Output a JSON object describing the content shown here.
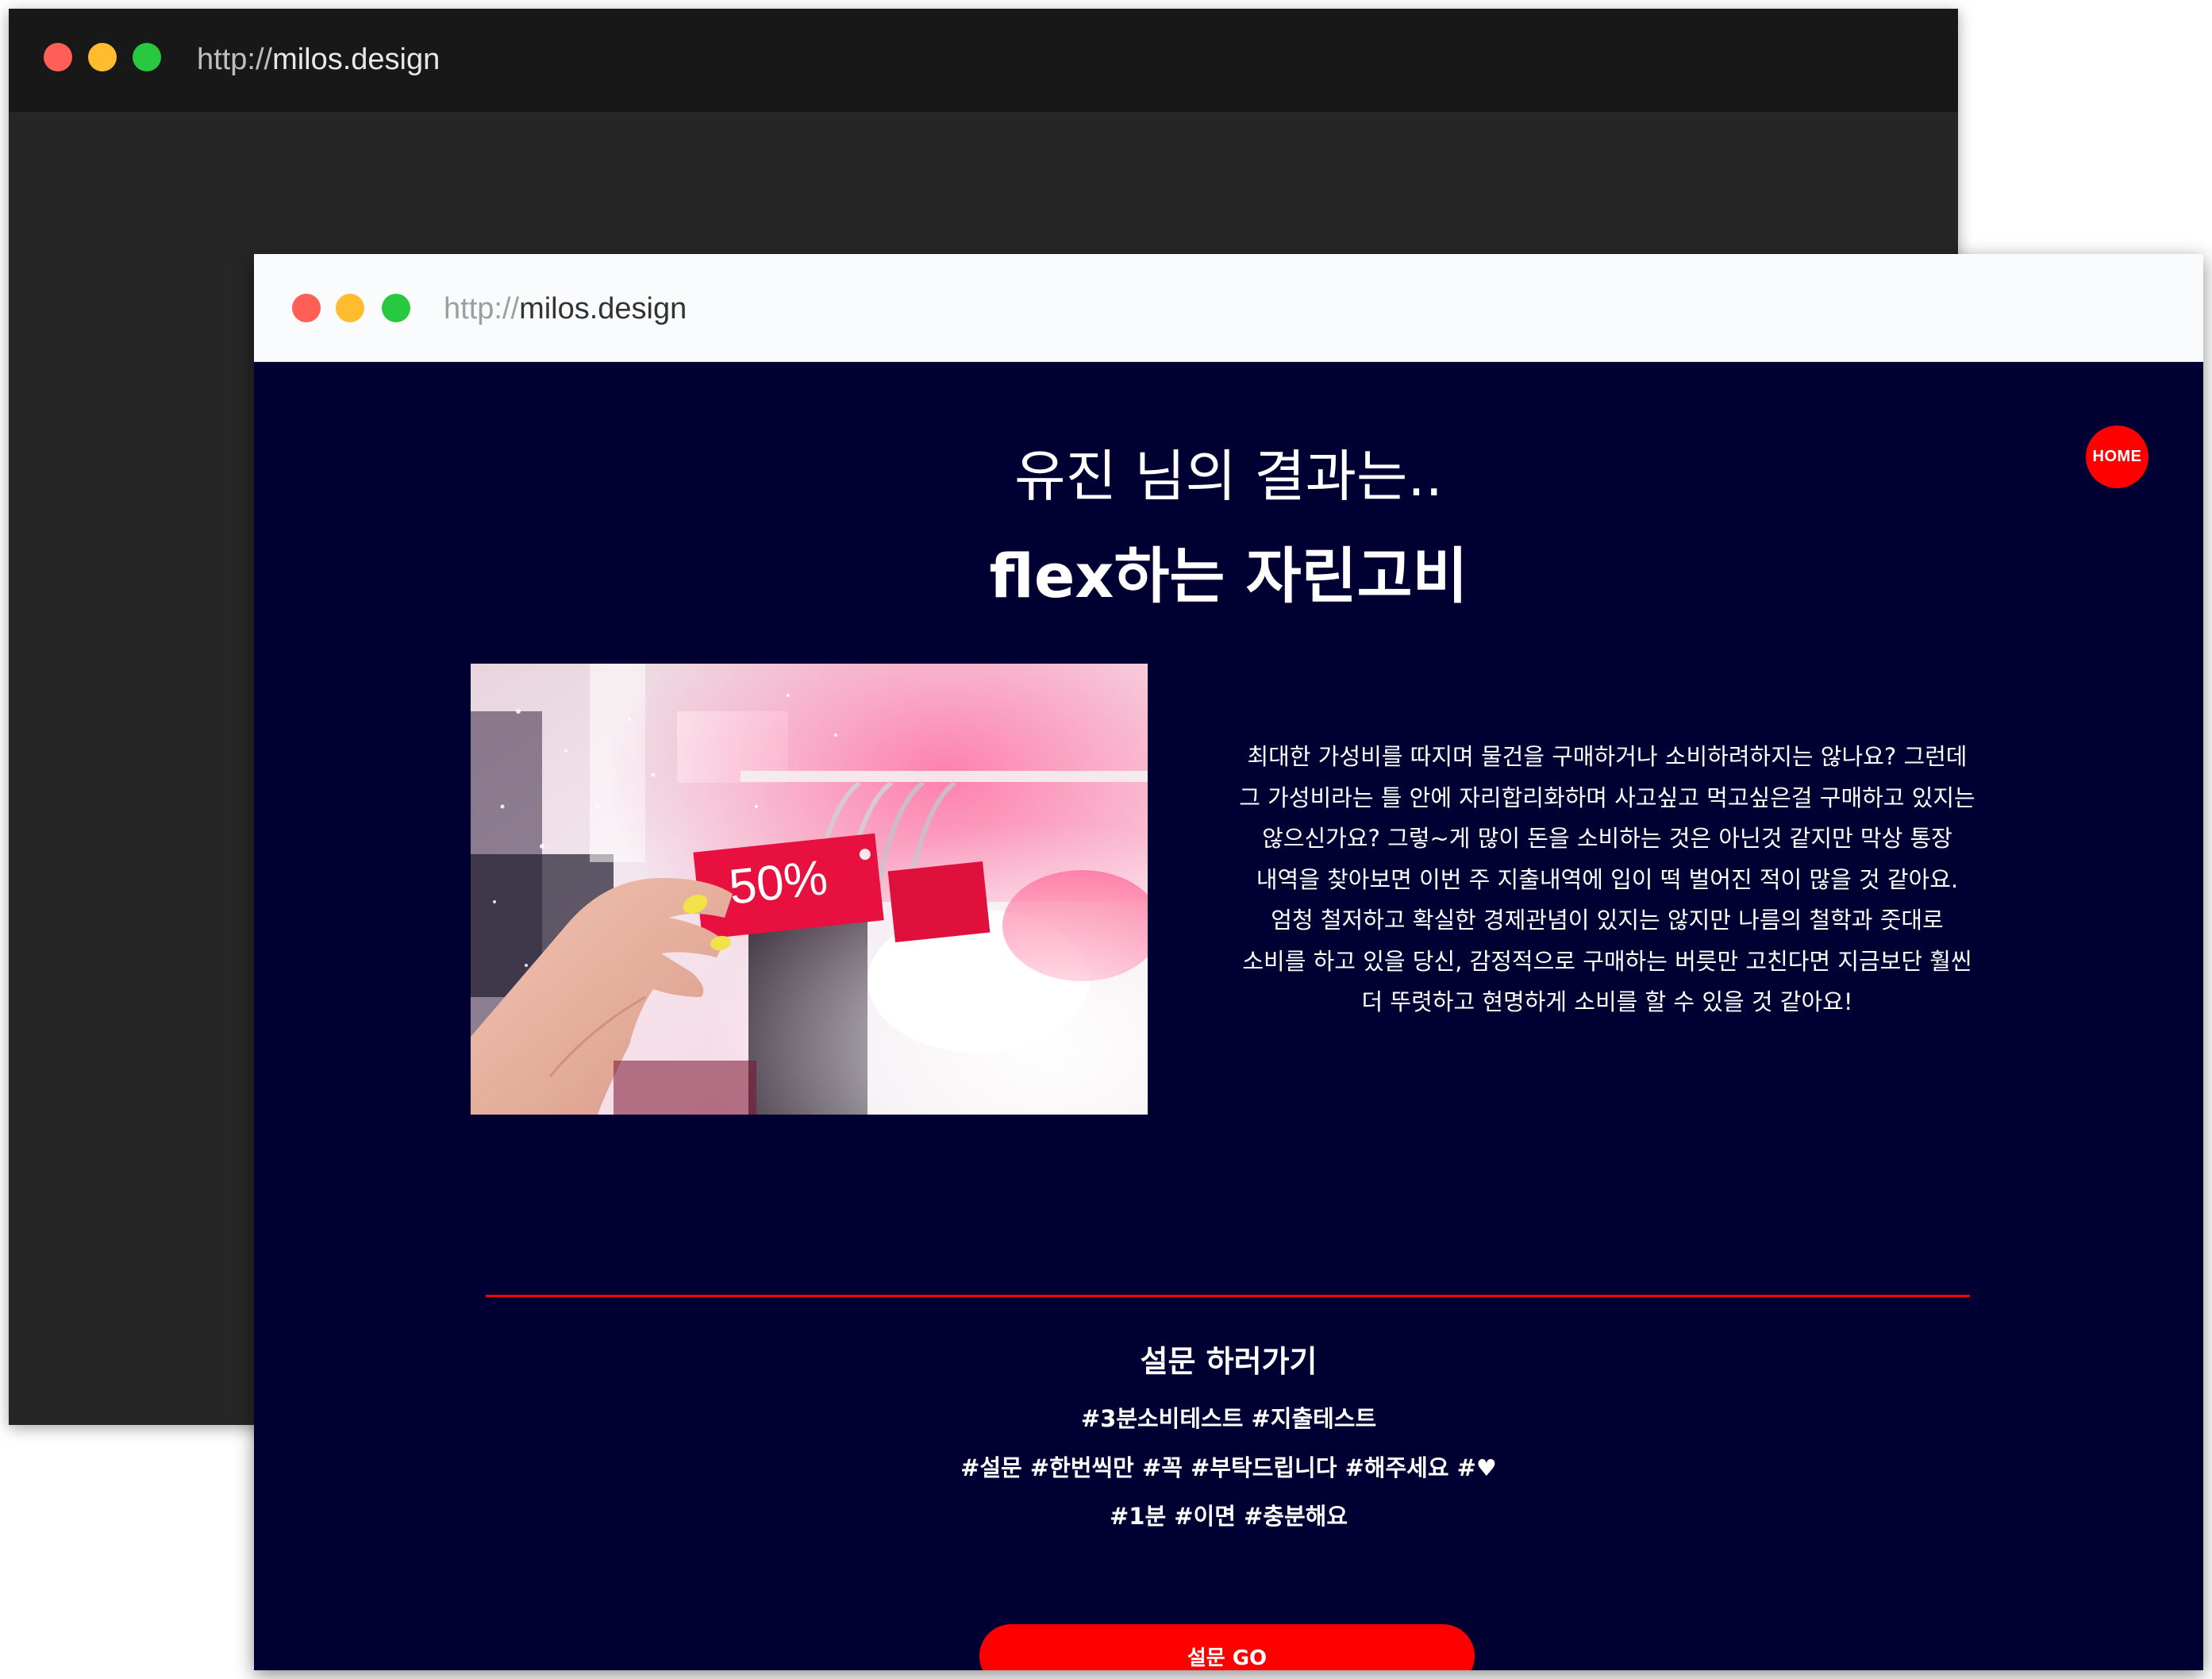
{
  "back_window": {
    "url_protocol": "http://",
    "url_host": "milos.design"
  },
  "front_window": {
    "url_protocol": "http://",
    "url_host": "milos.design"
  },
  "page": {
    "home_label": "HOME",
    "result_intro": "유진 님의 결과는..",
    "result_type": "flex하는 자린고비",
    "image": {
      "description_icon": "sale-tag-photo",
      "tag_text": "50%"
    },
    "description_lines": [
      "최대한 가성비를 따지며 물건을 구매하거나 소비하려하지는 않나요? 그런데",
      "그 가성비라는 틀 안에 자리합리화하며 사고싶고 먹고싶은걸 구매하고 있지는",
      "않으신가요? 그렇~게 많이 돈을 소비하는 것은 아닌것 같지만 막상 통장",
      "내역을 찾아보면 이번 주 지출내역에 입이 떡 벌어진 적이 많을 것 같아요.",
      "엄청 철저하고 확실한 경제관념이 있지는 않지만 나름의 철학과 줏대로",
      "소비를 하고 있을 당신, 감정적으로 구매하는 버릇만 고친다면 지금보단 훨씬",
      "더 뚜렷하고 현명하게 소비를 할 수 있을 것 같아요!"
    ],
    "survey_title": "설문 하러가기",
    "tags_line1": "#3분소비테스트 #지출테스트",
    "tags_line2": "#설문 #한번씩만 #꼭 #부탁드립니다 #해주세요 #",
    "tags_line2_heart": "♥",
    "tags_line3": "#1분 #이면 #충분해요",
    "go_label": "설문 GO"
  },
  "colors": {
    "page_bg": "#000033",
    "accent": "#ff0000",
    "back_titlebar": "#181818",
    "back_body": "#262626",
    "front_titlebar": "#fafbfc"
  }
}
